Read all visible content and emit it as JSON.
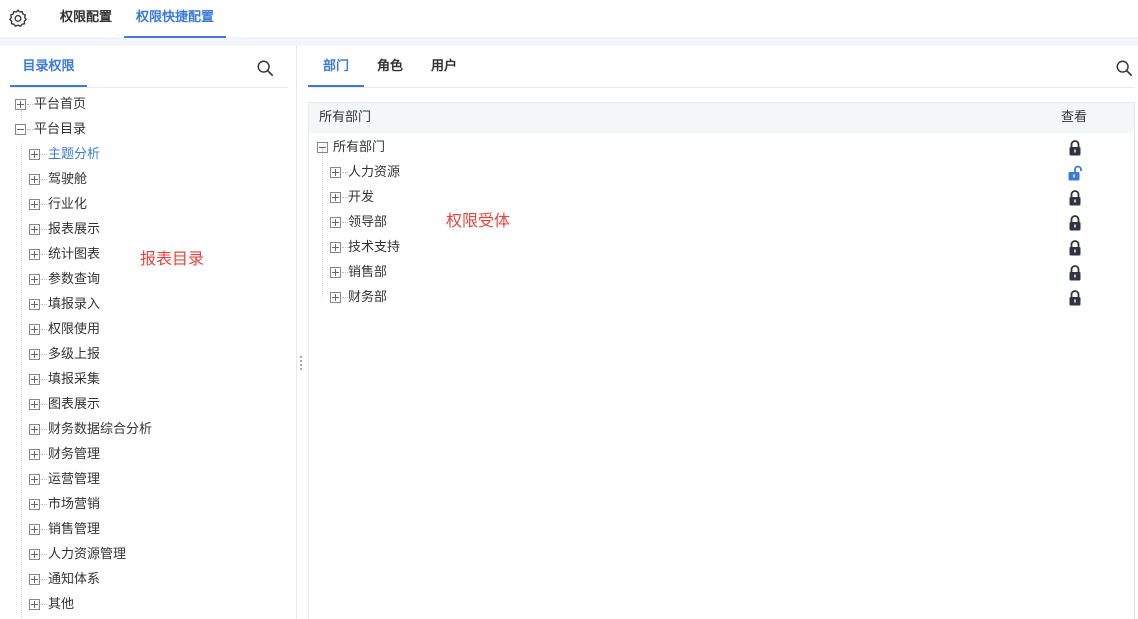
{
  "top_tabs": [
    "权限配置",
    "权限快捷配置"
  ],
  "left": {
    "tab": "目录权限",
    "tree": [
      {
        "label": "平台首页",
        "level": 0,
        "expanded": false
      },
      {
        "label": "平台目录",
        "level": 0,
        "expanded": true
      },
      {
        "label": "主题分析",
        "level": 1,
        "expanded": false,
        "active": true
      },
      {
        "label": "驾驶舱",
        "level": 1,
        "expanded": false
      },
      {
        "label": "行业化",
        "level": 1,
        "expanded": false
      },
      {
        "label": "报表展示",
        "level": 1,
        "expanded": false
      },
      {
        "label": "统计图表",
        "level": 1,
        "expanded": false
      },
      {
        "label": "参数查询",
        "level": 1,
        "expanded": false
      },
      {
        "label": "填报录入",
        "level": 1,
        "expanded": false
      },
      {
        "label": "权限使用",
        "level": 1,
        "expanded": false
      },
      {
        "label": "多级上报",
        "level": 1,
        "expanded": false
      },
      {
        "label": "填报采集",
        "level": 1,
        "expanded": false
      },
      {
        "label": "图表展示",
        "level": 1,
        "expanded": false
      },
      {
        "label": "财务数据综合分析",
        "level": 1,
        "expanded": false
      },
      {
        "label": "财务管理",
        "level": 1,
        "expanded": false
      },
      {
        "label": "运营管理",
        "level": 1,
        "expanded": false
      },
      {
        "label": "市场营销",
        "level": 1,
        "expanded": false
      },
      {
        "label": "销售管理",
        "level": 1,
        "expanded": false
      },
      {
        "label": "人力资源管理",
        "level": 1,
        "expanded": false
      },
      {
        "label": "通知体系",
        "level": 1,
        "expanded": false
      },
      {
        "label": "其他",
        "level": 1,
        "expanded": false
      }
    ],
    "annotation": "报表目录"
  },
  "right": {
    "tabs": [
      "部门",
      "角色",
      "用户"
    ],
    "header": {
      "name": "所有部门",
      "view": "查看"
    },
    "rows": [
      {
        "label": "所有部门",
        "level": 0,
        "expanded": true,
        "lock": "locked"
      },
      {
        "label": "人力资源",
        "level": 1,
        "expanded": false,
        "lock": "unlocked"
      },
      {
        "label": "开发",
        "level": 1,
        "expanded": false,
        "lock": "locked"
      },
      {
        "label": "领导部",
        "level": 1,
        "expanded": false,
        "lock": "locked"
      },
      {
        "label": "技术支持",
        "level": 1,
        "expanded": false,
        "lock": "locked"
      },
      {
        "label": "销售部",
        "level": 1,
        "expanded": false,
        "lock": "locked"
      },
      {
        "label": "财务部",
        "level": 1,
        "expanded": false,
        "lock": "locked"
      }
    ],
    "annotation": "权限受体"
  },
  "colors": {
    "accent": "#3d7bd8",
    "annotation": "#e8433b",
    "lock_dark": "#2f3440"
  }
}
